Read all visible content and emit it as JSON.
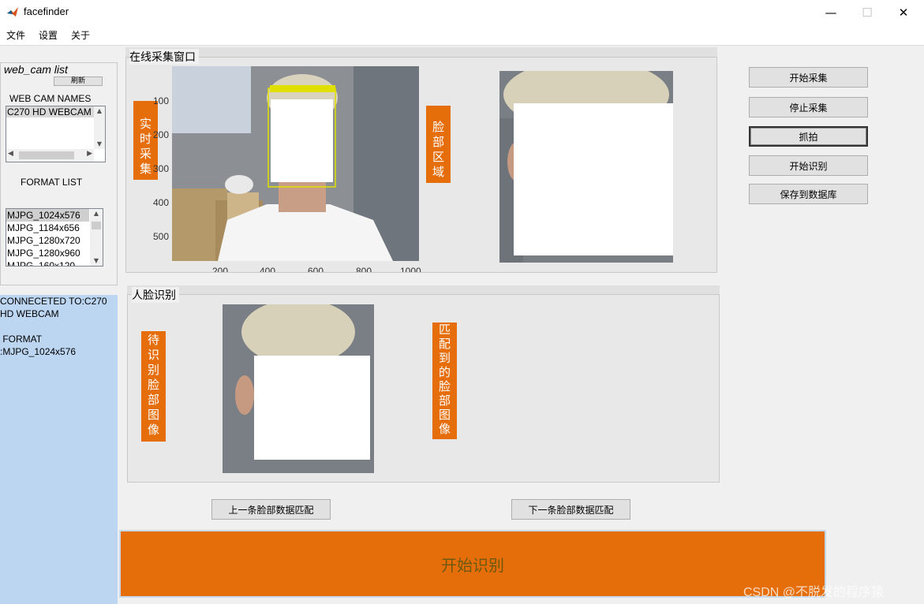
{
  "window": {
    "title": "facefinder",
    "controls": {
      "minimize": "—",
      "maximize": "☐",
      "close": "✕"
    }
  },
  "menu": [
    "文件",
    "设置",
    "关于"
  ],
  "webcam": {
    "title": "web_cam list",
    "refresh_label": "刷新",
    "names_label": "WEB  CAM NAMES",
    "names": [
      "C270 HD WEBCAM"
    ],
    "format_label": "FORMAT LIST",
    "formats": [
      "MJPG_1024x576",
      "MJPG_1184x656",
      "MJPG_1280x720",
      "MJPG_1280x960",
      "MJPG_160x120"
    ],
    "selected_format_index": 0
  },
  "status": {
    "text": "CONNECETED TO:C270 HD WEBCAM\n\n FORMAT\n:MJPG_1024x576"
  },
  "capture": {
    "title": "在线采集窗口",
    "realtime_label": "实时采集",
    "face_region_label": "脸部区域",
    "y_ticks": [
      "100",
      "200",
      "300",
      "400",
      "500"
    ],
    "x_ticks": [
      "200",
      "400",
      "600",
      "800",
      "1000"
    ]
  },
  "actions": {
    "start_capture": "开始采集",
    "stop_capture": "停止采集",
    "snapshot": "抓拍",
    "start_recognition": "开始识别",
    "save_to_db": "保存到数据库"
  },
  "recognition": {
    "title": "人脸识别",
    "probe_label": "待识别脸部图像",
    "matched_label": "匹配到的脸部图像",
    "prev_match": "上一条脸部数据匹配",
    "next_match": "下一条脸部数据匹配"
  },
  "big_button": {
    "label": "开始识别"
  },
  "watermark": "CSDN @不脱发的程序猿",
  "colors": {
    "accent": "#e56d0a",
    "status_bg": "#bcd6f2",
    "detect_box": "#e0e000"
  },
  "icons": {
    "app": "matlab-logo-icon"
  }
}
